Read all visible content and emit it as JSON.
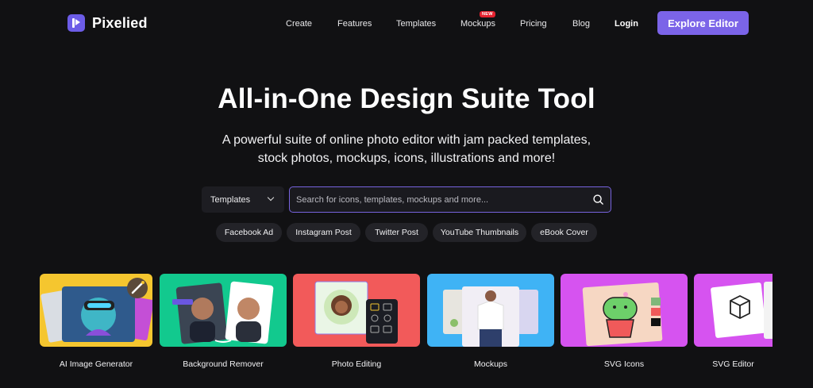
{
  "brand": {
    "name": "Pixelied"
  },
  "nav": {
    "links": [
      "Create",
      "Features",
      "Templates",
      "Mockups",
      "Pricing",
      "Blog"
    ],
    "login": "Login",
    "new_badge": "NEW",
    "cta": "Explore Editor"
  },
  "hero": {
    "title": "All-in-One Design Suite Tool",
    "subtitle": "A powerful suite of online photo editor with jam packed templates, stock photos, mockups, icons, illustrations and more!"
  },
  "search": {
    "category": "Templates",
    "placeholder": "Search for icons, templates, mockups and more..."
  },
  "chips": [
    "Facebook Ad",
    "Instagram Post",
    "Twitter Post",
    "YouTube Thumbnails",
    "eBook Cover"
  ],
  "tools": [
    {
      "label": "AI Image Generator",
      "bg": "#f5c62f"
    },
    {
      "label": "Background Remover",
      "bg": "#12c98e"
    },
    {
      "label": "Photo Editing",
      "bg": "#f25a5a"
    },
    {
      "label": "Mockups",
      "bg": "#3fb3f5"
    },
    {
      "label": "SVG Icons",
      "bg": "#d653f0"
    },
    {
      "label": "SVG Editor",
      "bg": "#d653f0"
    }
  ],
  "colors": {
    "accent": "#7b64e8",
    "background": "#111113",
    "badge": "#e5222f"
  }
}
